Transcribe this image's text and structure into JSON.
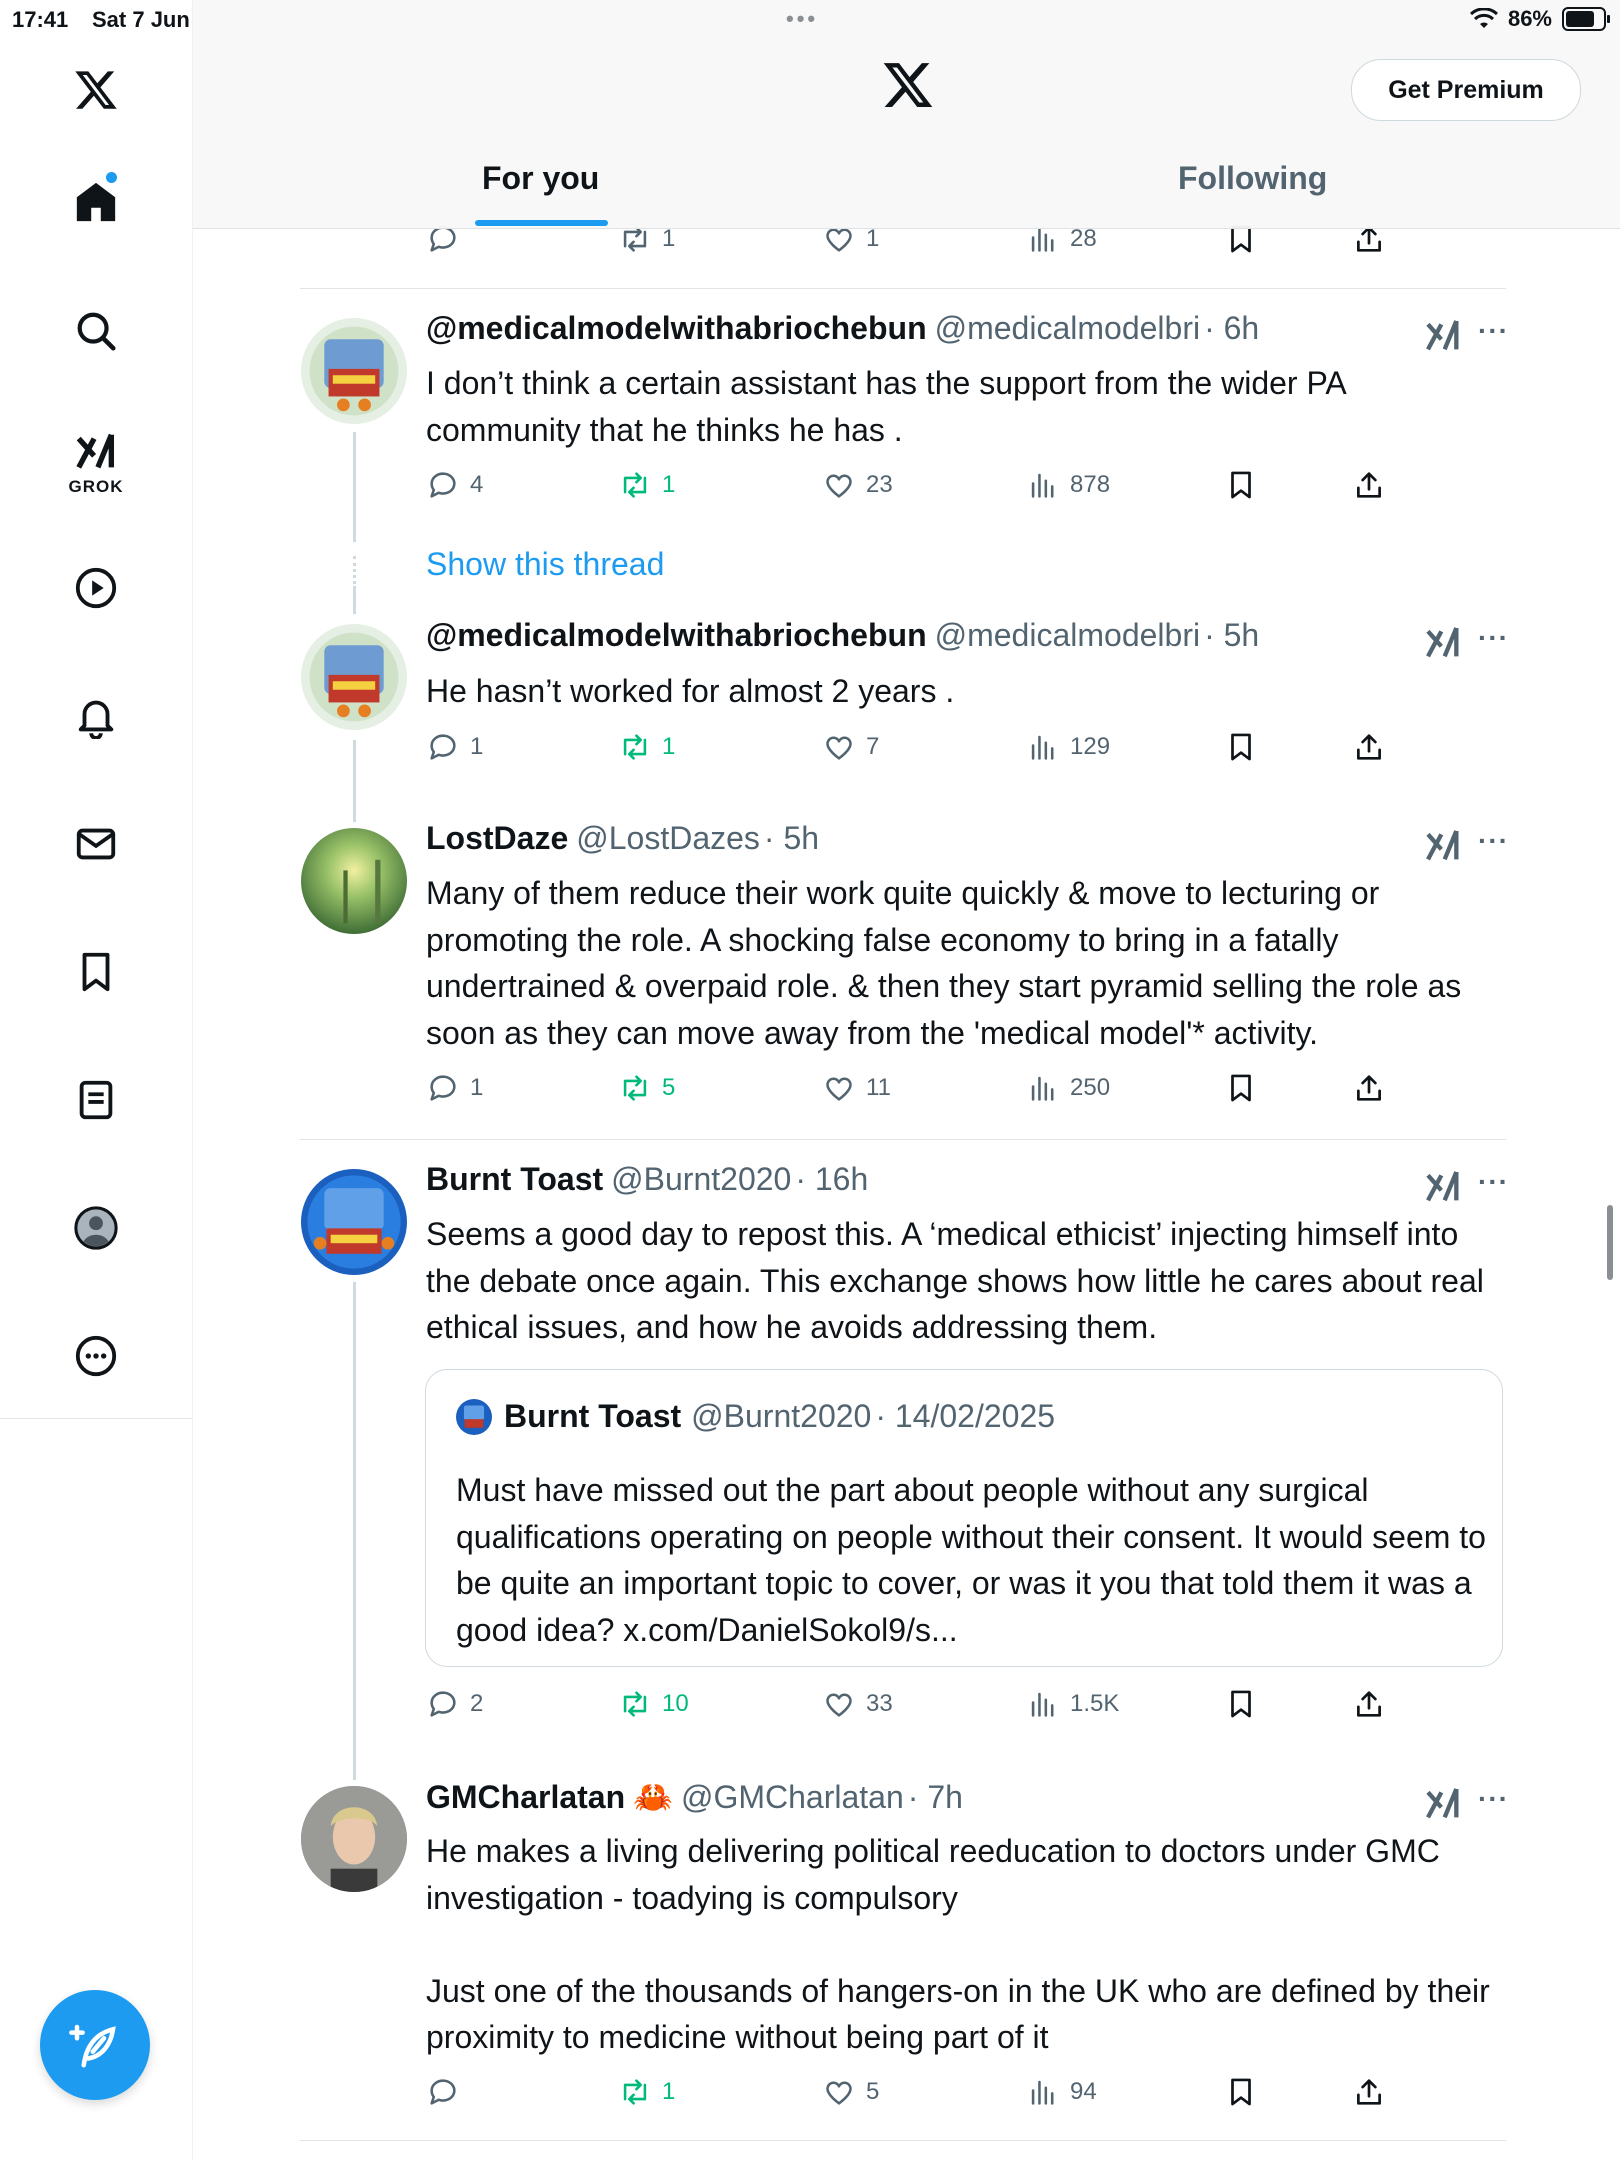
{
  "status_bar": {
    "time": "17:41",
    "date": "Sat 7 Jun",
    "battery": "86%",
    "battery_level": 0.86
  },
  "sidebar": {
    "grok_label": "GROK",
    "items": [
      "home-icon",
      "search-icon",
      "grok-icon",
      "video-icon",
      "bell-icon",
      "mail-icon",
      "bookmark-icon",
      "lists-icon",
      "profile-icon",
      "more-icon"
    ]
  },
  "header": {
    "premium_label": "Get Premium",
    "tabs": [
      {
        "label": "For you",
        "active": true
      },
      {
        "label": "Following",
        "active": false
      }
    ]
  },
  "top_actions": {
    "reply": "",
    "repost": "1",
    "like": "1",
    "views": "28"
  },
  "posts": [
    {
      "name": "@medicalmodelwithabriochebun",
      "handle": "@medicalmodelbri",
      "time": "· 6h",
      "text": "I don’t think a certain assistant has the support from the wider PA community that he thinks he has .",
      "avatar_text": "General Medical Council NO CONFIDENCE",
      "reply": "4",
      "repost": "1",
      "like": "23",
      "views": "878"
    },
    {
      "name": "@medicalmodelwithabriochebun",
      "handle": "@medicalmodelbri",
      "time": "· 5h",
      "text": "He hasn’t worked for almost 2 years .",
      "reply": "1",
      "repost": "1",
      "like": "7",
      "views": "129"
    },
    {
      "name": "LostDaze",
      "handle": "@LostDazes",
      "time": "· 5h",
      "text": "Many of them reduce their work  quite quickly & move to lecturing or promoting the role. A shocking false economy to bring in a fatally undertrained & overpaid role. & then they start pyramid selling the role as soon as they can move away from the 'medical model'* activity.",
      "reply": "1",
      "repost": "5",
      "like": "11",
      "views": "250"
    },
    {
      "name": "Burnt Toast",
      "handle": "@Burnt2020",
      "time": "· 16h",
      "text": "Seems a good day to repost this. A ‘medical ethicist’ injecting himself into the debate once again. This exchange shows how little he cares about real ethical issues, and how he avoids addressing them.",
      "quote": {
        "name": "Burnt Toast",
        "handle": "@Burnt2020",
        "time": "· 14/02/2025",
        "text": "Must have missed out the part about people without any surgical qualifications operating on people without their consent. It would seem to be quite an important topic to cover, or was it you that told them it was a good idea? x.com/DanielSokol9/s..."
      },
      "reply": "2",
      "repost": "10",
      "like": "33",
      "views": "1.5K"
    },
    {
      "name": "GMCharlatan",
      "emoji": "🦀",
      "handle": "@GMCharlatan",
      "time": "· 7h",
      "text": "He makes a living delivering political reeducation to doctors under GMC investigation - toadying is compulsory\n\nJust one of the thousands of hangers-on in the UK who are defined by their proximity to medicine without being part of it",
      "reply": "",
      "repost": "1",
      "like": "5",
      "views": "94"
    }
  ],
  "show_thread": "Show this thread"
}
